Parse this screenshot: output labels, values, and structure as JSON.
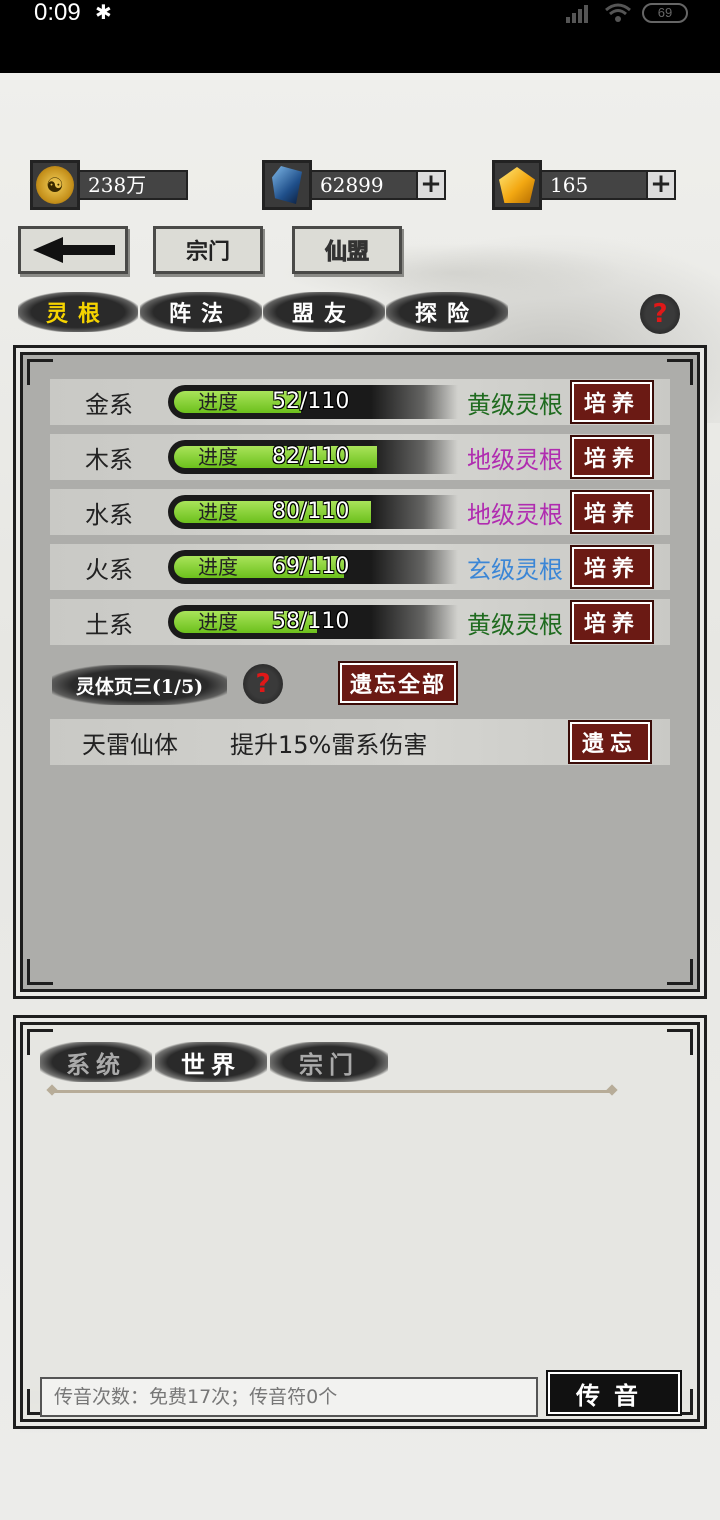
{
  "status_bar": {
    "time": "0:09",
    "bluetooth_glyph": "✱",
    "battery": "69"
  },
  "currency": {
    "coins": {
      "icon": "taiji-coin-icon",
      "value": "238万"
    },
    "crystals": {
      "icon": "blue-crystal-icon",
      "value": "62899"
    },
    "gems": {
      "icon": "gold-gem-icon",
      "value": "165"
    },
    "plus": "+"
  },
  "nav": {
    "sect_label": "宗门",
    "alliance_label": "仙盟"
  },
  "subtabs": [
    "灵根",
    "阵法",
    "盟友",
    "探险"
  ],
  "help": "?",
  "roots": [
    {
      "name": "金系",
      "progress_label": "进度",
      "value": "52/110",
      "progress": 0.47,
      "grade": "黄级灵根",
      "grade_color": "#1f6b1f",
      "button": "培养"
    },
    {
      "name": "木系",
      "progress_label": "进度",
      "value": "82/110",
      "progress": 0.75,
      "grade": "地级灵根",
      "grade_color": "#b02cb0",
      "button": "培养"
    },
    {
      "name": "水系",
      "progress_label": "进度",
      "value": "80/110",
      "progress": 0.73,
      "grade": "地级灵根",
      "grade_color": "#b02cb0",
      "button": "培养"
    },
    {
      "name": "火系",
      "progress_label": "进度",
      "value": "69/110",
      "progress": 0.63,
      "grade": "玄级灵根",
      "grade_color": "#3b86d6",
      "button": "培养"
    },
    {
      "name": "土系",
      "progress_label": "进度",
      "value": "58/110",
      "progress": 0.53,
      "grade": "黄级灵根",
      "grade_color": "#1f6b1f",
      "button": "培养"
    }
  ],
  "spirit_body": {
    "label": "灵体页三(1/5)",
    "forget_all": "遗忘全部",
    "item": {
      "name": "天雷仙体",
      "effect": "提升15%雷系伤害",
      "button": "遗忘"
    }
  },
  "chat": {
    "tabs": [
      "系统",
      "世界",
      "宗门"
    ],
    "placeholder": "传音次数：免费17次；传音符0个",
    "send": "传音"
  }
}
